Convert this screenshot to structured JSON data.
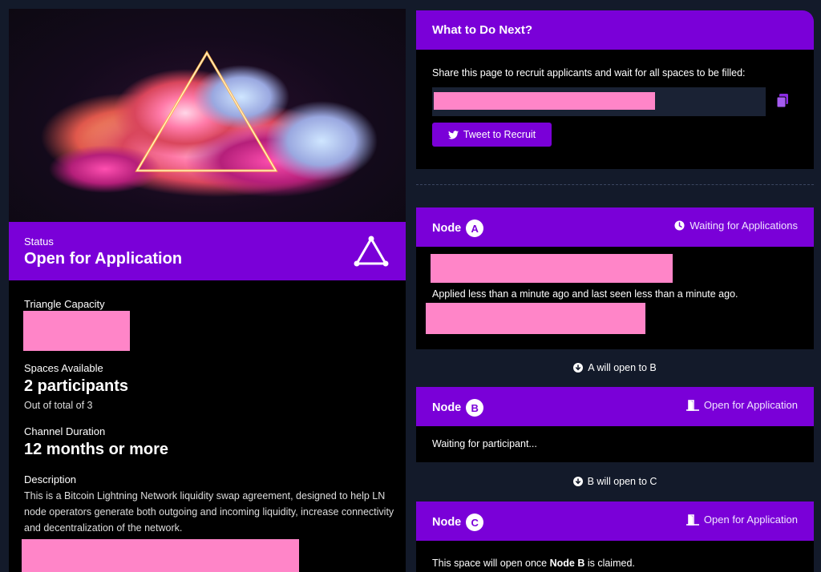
{
  "left": {
    "status": {
      "label": "Status",
      "value": "Open for Application"
    },
    "capacity": {
      "label": "Triangle Capacity"
    },
    "spaces": {
      "label": "Spaces Available",
      "value": "2 participants",
      "sub": "Out of total of 3"
    },
    "duration": {
      "label": "Channel Duration",
      "value": "12 months or more"
    },
    "description": {
      "label": "Description",
      "text": "This is a Bitcoin Lightning Network liquidity swap agreement, designed to help LN node operators generate both outgoing and incoming liquidity, increase connectivity and decentralization of the network."
    }
  },
  "next": {
    "title": "What to Do Next?",
    "share_text": "Share this page to recruit applicants and wait for all spaces to be filled:",
    "tweet_label": "Tweet to Recruit"
  },
  "nodes": [
    {
      "label": "Node",
      "letter": "A",
      "status": "Waiting for Applications",
      "status_icon": "clock-icon",
      "text": "Applied less than a minute ago and last seen less than a minute ago."
    },
    {
      "label": "Node",
      "letter": "B",
      "status": "Open for Application",
      "status_icon": "door-open-icon",
      "text": "Waiting for participant..."
    },
    {
      "label": "Node",
      "letter": "C",
      "status": "Open for Application",
      "status_icon": "door-open-icon",
      "text_pre": "This space will open once ",
      "text_bold": "Node B",
      "text_post": " is claimed."
    }
  ],
  "links": [
    "A will open to B",
    "B will open to C"
  ],
  "colors": {
    "accent": "#7a00d8",
    "background": "#131a2a",
    "card": "#000000",
    "redaction": "#ff85c8"
  }
}
